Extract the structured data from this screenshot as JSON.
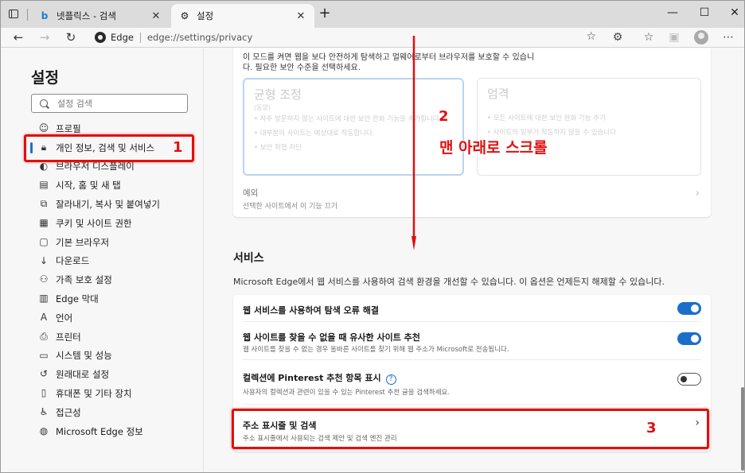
{
  "tabs": [
    {
      "title": "넷플릭스 - 검색",
      "favicon": "bing-icon"
    },
    {
      "title": "설정",
      "favicon": "gear-icon"
    }
  ],
  "window": {
    "minimize": "—",
    "maximize": "☐",
    "close": "✕"
  },
  "address": {
    "brand": "Edge",
    "url": "edge://settings/privacy"
  },
  "sidebar": {
    "title": "설정",
    "search_placeholder": "설정 검색",
    "items": [
      {
        "label": "프로필",
        "icon": "profile-icon"
      },
      {
        "label": "개인 정보, 검색 및 서비스",
        "icon": "lock-icon",
        "active": true
      },
      {
        "label": "브라우저 디스플레이",
        "icon": "display-icon"
      },
      {
        "label": "시작, 홈 및 새 탭",
        "icon": "home-icon"
      },
      {
        "label": "잘라내기, 복사 및 붙여넣기",
        "icon": "clipboard-icon"
      },
      {
        "label": "쿠키 및 사이트 권한",
        "icon": "cookie-icon"
      },
      {
        "label": "기본 브라우저",
        "icon": "browser-icon"
      },
      {
        "label": "다운로드",
        "icon": "download-icon"
      },
      {
        "label": "가족 보호 설정",
        "icon": "family-icon"
      },
      {
        "label": "Edge 막대",
        "icon": "edge-bar-icon"
      },
      {
        "label": "언어",
        "icon": "language-icon"
      },
      {
        "label": "프린터",
        "icon": "printer-icon"
      },
      {
        "label": "시스템 및 성능",
        "icon": "system-icon"
      },
      {
        "label": "원래대로 설정",
        "icon": "reset-icon"
      },
      {
        "label": "휴대폰 및 기타 장치",
        "icon": "phone-icon"
      },
      {
        "label": "접근성",
        "icon": "accessibility-icon"
      },
      {
        "label": "Microsoft Edge 정보",
        "icon": "edge-icon"
      }
    ]
  },
  "tracking": {
    "intro_line1": "이 모드를 켜면 웹을 보다 안전하게 탐색하고 멀웨어로부터 브라우저를 보호할 수 있습니",
    "intro_line2": "다. 필요한 보안 수준을 선택하세요.",
    "balanced": {
      "title": "균형 조정",
      "subtitle": "(동영)",
      "bullets": [
        "자주 방문하지 않는 사이트에 대한 보안 완화 기능을 추가합니다.",
        "대부분의 사이트는 예상대로 작동합니다.",
        "보안 위협 차단"
      ]
    },
    "strict": {
      "title": "엄격",
      "bullets": [
        "모든 사이트에 대한 보안 완화 기능 추가",
        "사이트의 일부가 작동하지 않을 수 있습니다"
      ]
    },
    "exceptions_title": "예외",
    "exceptions_sub": "선택한 사이트에서 이 기능 끄기"
  },
  "services": {
    "title": "서비스",
    "description": "Microsoft Edge에서 웹 서비스를 사용하여 검색 환경을 개선할 수 있습니다. 이 옵션은 언제든지 해제할 수 있습니다.",
    "rows": [
      {
        "title": "웹 서비스를 사용하여 탐색 오류 해결",
        "sub": "",
        "control": "toggle",
        "on": true
      },
      {
        "title": "웹 사이트를 찾을 수 없을 때 유사한 사이트 추천",
        "sub": "웹 사이트를 찾을 수 없는 경우 올바른 사이트를 찾기 위해 웹 주소가 Microsoft로 전송됩니다.",
        "control": "toggle",
        "on": true
      },
      {
        "title": "컬렉션에 Pinterest 추천 항목 표시",
        "sub": "사용자의 컬렉션과 관련이 있을 수 있는 Pinterest 추천 글을 검색하세요.",
        "control": "toggle",
        "on": false,
        "help": "?"
      },
      {
        "title": "주소 표시줄 및 검색",
        "sub": "주소 표시줄에서 사용되는 검색 제안 및 검색 엔진 관리",
        "control": "chevron"
      }
    ]
  },
  "annotations": {
    "step1": "1",
    "step2": "2",
    "step2_text": "맨 아래로 스크롤",
    "step3": "3",
    "color": "#e01010"
  },
  "colors": {
    "accent": "#1b6fcb",
    "annotation": "#e01010"
  }
}
